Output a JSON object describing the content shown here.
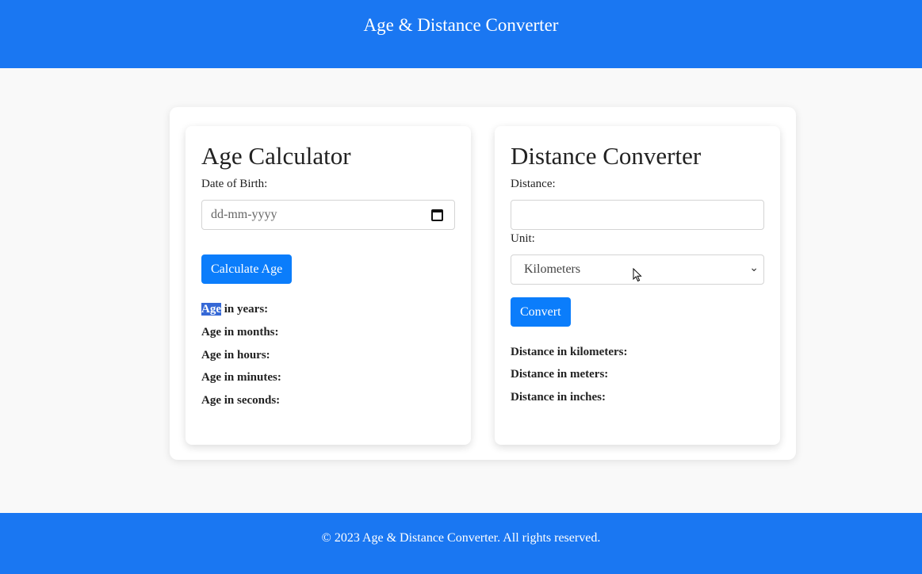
{
  "header": {
    "title": "Age & Distance Converter"
  },
  "age": {
    "title": "Age Calculator",
    "dob_label": "Date of Birth:",
    "dob_placeholder": "dd-mm-yyyy",
    "button": "Calculate Age",
    "results": {
      "years_word": "Age",
      "years_rest": " in years:",
      "months": "Age in months:",
      "hours": "Age in hours:",
      "minutes": "Age in minutes:",
      "seconds": "Age in seconds:"
    }
  },
  "distance": {
    "title": "Distance Converter",
    "distance_label": "Distance:",
    "distance_value": "",
    "unit_label": "Unit:",
    "unit_selected": "Kilometers",
    "button": "Convert",
    "results": {
      "km": "Distance in kilometers:",
      "m": "Distance in meters:",
      "in": "Distance in inches:"
    }
  },
  "footer": {
    "text": "© 2023 Age & Distance Converter. All rights reserved."
  },
  "colors": {
    "brand": "#1a77f2",
    "button": "#0b7dfb",
    "selection": "#3568d6"
  },
  "icons": {
    "date": "calendar-icon",
    "select": "chevron-down-icon",
    "cursor": "mouse-pointer-icon"
  }
}
